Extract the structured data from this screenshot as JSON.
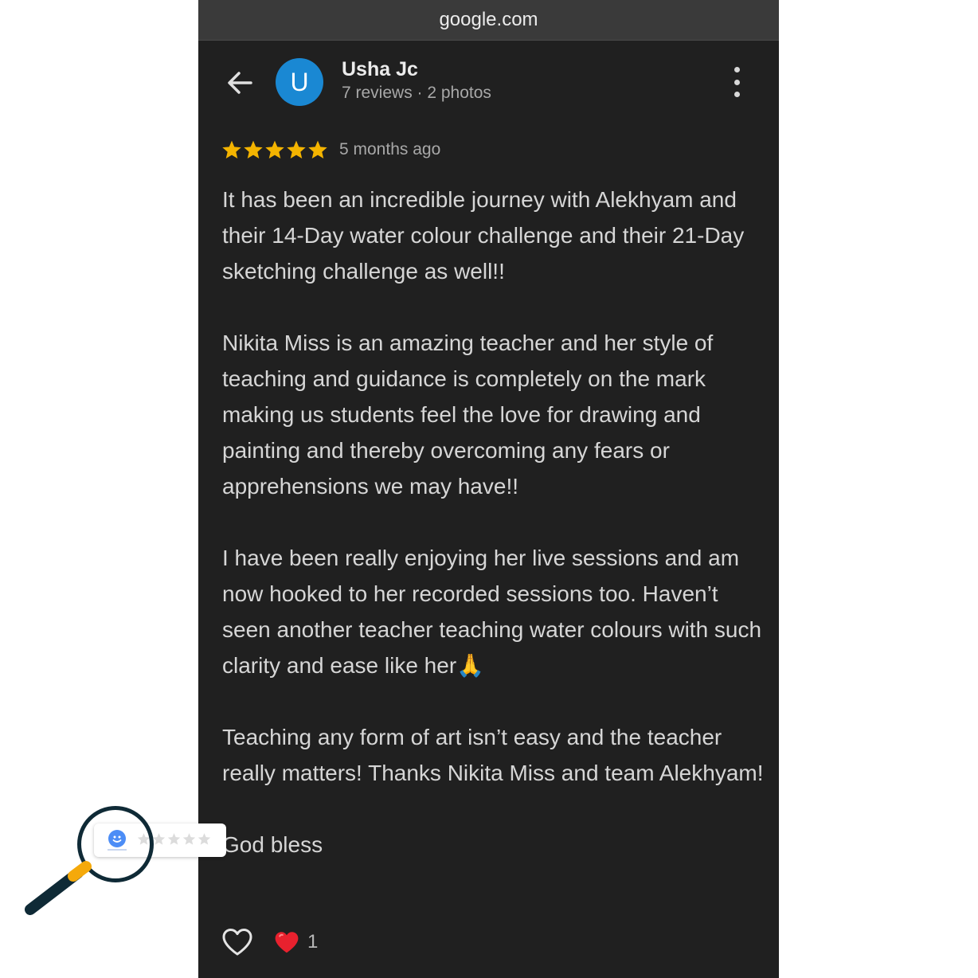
{
  "browser": {
    "url": "google.com"
  },
  "header": {
    "back_icon": "arrow-left-icon",
    "avatar_letter": "U",
    "avatar_color": "#1a88d3",
    "user_name": "Usha Jc",
    "user_meta": "7 reviews · 2 photos",
    "more_icon": "more-vertical-icon"
  },
  "review": {
    "rating": 5,
    "rating_max": 5,
    "star_color": "#f4b400",
    "time": "5 months ago",
    "paragraphs": [
      "It has been an incredible journey with Alekhyam and their 14-Day water colour challenge and their 21-Day sketching challenge as well!!",
      "Nikita Miss is an amazing teacher and her style of teaching and guidance is completely on the mark making us students feel the love for drawing and painting and thereby overcoming any fears or apprehensions we may have!!",
      "I have been really enjoying her live sessions and am now hooked to her recorded sessions too. Haven’t seen another teacher teaching water colours with such clarity and ease like her🙏",
      "Teaching any form of art isn’t easy and the teacher really matters! Thanks Nikita Miss and team Alekhyam!",
      "God bless"
    ]
  },
  "actions": {
    "like_icon": "heart-outline-icon",
    "reaction_icon": "red-heart-icon",
    "reaction_count": "1"
  },
  "overlay": {
    "icon": "magnifying-glass-icon",
    "mini_rating": 0,
    "mini_rating_max": 5
  }
}
